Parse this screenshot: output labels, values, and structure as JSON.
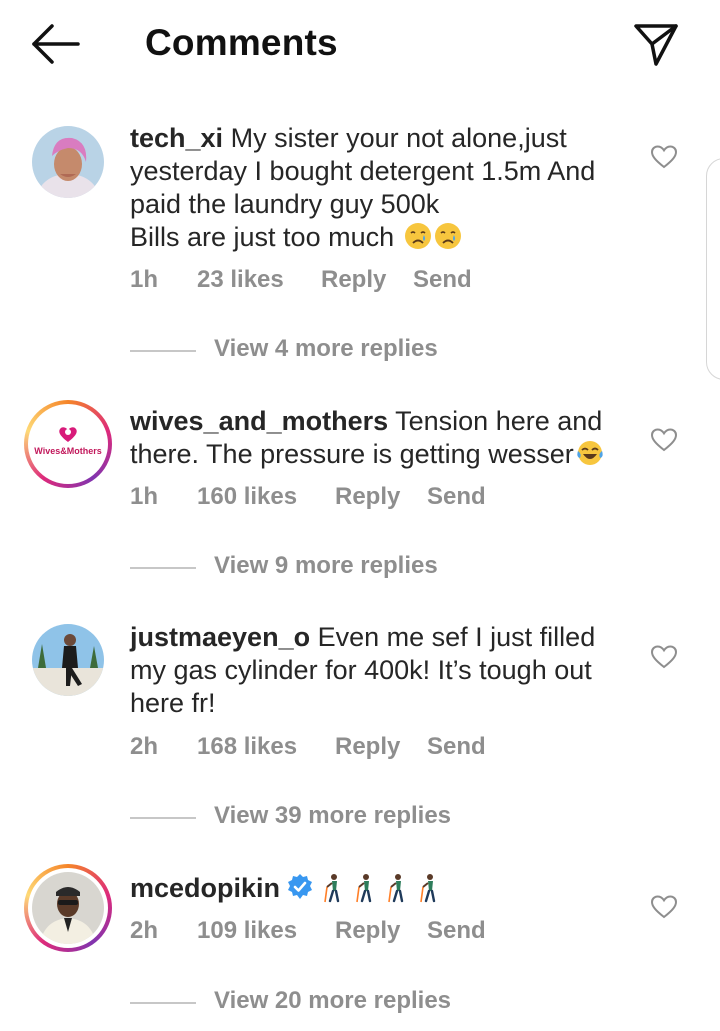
{
  "header": {
    "title": "Comments",
    "back_icon": "arrow-left-icon",
    "send_icon": "paper-plane-icon"
  },
  "colors": {
    "text": "#262626",
    "meta": "#8e8e8e",
    "verified": "#3897f0",
    "story_ring": [
      "#f58529",
      "#dd2a7b",
      "#8134af",
      "#feda77"
    ]
  },
  "comments": [
    {
      "username": "tech_xi",
      "text_lines": [
        "My sister your not alone,just",
        "yesterday I bought detergent 1.5m And",
        "paid the laundry guy 500k",
        "Bills are just too much"
      ],
      "emojis": [
        "crying-face-emoji",
        "crying-face-emoji"
      ],
      "time": "1h",
      "likes": "23 likes",
      "reply": "Reply",
      "send": "Send",
      "view_replies": "View 4 more replies"
    },
    {
      "username": "wives_and_mothers",
      "avatar_text": "Wives&Mothers",
      "text_lines": [
        "Tension here and",
        "there. The pressure is getting wesser"
      ],
      "emojis": [
        "tears-of-joy-emoji"
      ],
      "time": "1h",
      "likes": "160 likes",
      "reply": "Reply",
      "send": "Send",
      "view_replies": "View 9 more replies"
    },
    {
      "username": "justmaeyen_o",
      "text_lines": [
        "Even me sef I just filled",
        "my gas cylinder for 400k! It’s tough out",
        "here fr!"
      ],
      "time": "2h",
      "likes": "168 likes",
      "reply": "Reply",
      "send": "Send",
      "view_replies": "View 39 more replies"
    },
    {
      "username": "mcedopikin",
      "verified": true,
      "emojis": [
        "person-with-cane-emoji",
        "person-with-cane-emoji",
        "person-with-cane-emoji",
        "person-with-cane-emoji"
      ],
      "time": "2h",
      "likes": "109 likes",
      "reply": "Reply",
      "send": "Send",
      "view_replies": "View 20 more replies"
    }
  ]
}
